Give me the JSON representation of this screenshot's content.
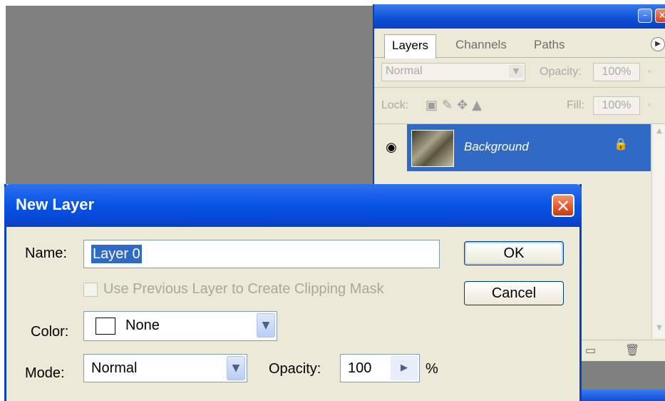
{
  "dialog": {
    "title": "New Layer",
    "close_symbol": "✕",
    "name_label": "Name:",
    "name_value": "Layer 0",
    "clipping_label": "Use Previous Layer to Create Clipping Mask",
    "color_label": "Color:",
    "color_value": "None",
    "mode_label": "Mode:",
    "mode_value": "Normal",
    "opacity_label": "Opacity:",
    "opacity_value": "100",
    "opacity_unit": "%",
    "ok_label": "OK",
    "cancel_label": "Cancel"
  },
  "layers_panel": {
    "tabs": [
      "Layers",
      "Channels",
      "Paths"
    ],
    "blend_mode": "Normal",
    "opacity_label": "Opacity:",
    "opacity_value": "100%",
    "lock_label": "Lock:",
    "fill_label": "Fill:",
    "fill_value": "100%",
    "layers": [
      {
        "name": "Background"
      }
    ]
  },
  "colors": {
    "xp_blue": "#0a56e6",
    "selection": "#316ac5",
    "canvas_gray": "#808080",
    "dialog_bg": "#ece9d8",
    "close_red": "#e35b2e"
  }
}
